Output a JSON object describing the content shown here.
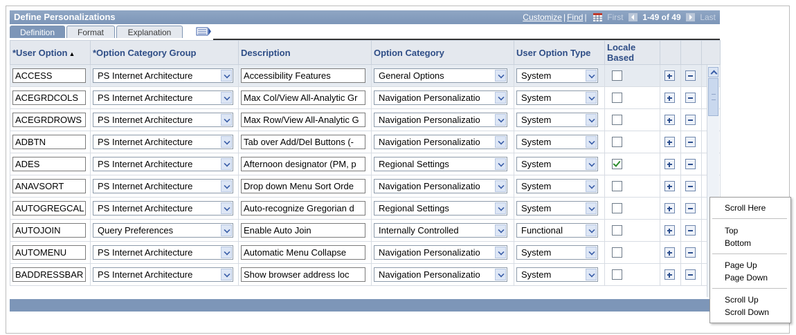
{
  "header": {
    "title": "Define Personalizations",
    "customize": "Customize",
    "find": "Find",
    "first": "First",
    "range": "1-49 of 49",
    "last": "Last"
  },
  "tabs": [
    "Definition",
    "Format",
    "Explanation"
  ],
  "columns": [
    "*User Option",
    "*Option Category Group",
    "Description",
    "Option Category",
    "User Option Type",
    "Locale Based"
  ],
  "rows": [
    {
      "user_option": "ACCESS",
      "group": "PS Internet Architecture",
      "description": "Accessibility Features",
      "category": "General Options",
      "type": "System",
      "locale": false
    },
    {
      "user_option": "ACEGRDCOLS",
      "group": "PS Internet Architecture",
      "description": "Max Col/View All-Analytic Gr",
      "category": "Navigation Personalizatio",
      "type": "System",
      "locale": false
    },
    {
      "user_option": "ACEGRDROWS",
      "group": "PS Internet Architecture",
      "description": "Max Row/View All-Analytic G",
      "category": "Navigation Personalizatio",
      "type": "System",
      "locale": false
    },
    {
      "user_option": "ADBTN",
      "group": "PS Internet Architecture",
      "description": "Tab over Add/Del Buttons (-",
      "category": "Navigation Personalizatio",
      "type": "System",
      "locale": false
    },
    {
      "user_option": "ADES",
      "group": "PS Internet Architecture",
      "description": "Afternoon designator (PM, p",
      "category": "Regional Settings",
      "type": "System",
      "locale": true
    },
    {
      "user_option": "ANAVSORT",
      "group": "PS Internet Architecture",
      "description": "Drop down Menu Sort Orde",
      "category": "Navigation Personalizatio",
      "type": "System",
      "locale": false
    },
    {
      "user_option": "AUTOGREGCAL",
      "group": "PS Internet Architecture",
      "description": "Auto-recognize Gregorian d",
      "category": "Regional Settings",
      "type": "System",
      "locale": false
    },
    {
      "user_option": "AUTOJOIN",
      "group": "Query Preferences",
      "description": "Enable Auto Join",
      "category": "Internally Controlled",
      "type": "Functional",
      "locale": false
    },
    {
      "user_option": "AUTOMENU",
      "group": "PS Internet Architecture",
      "description": "Automatic Menu Collapse",
      "category": "Navigation Personalizatio",
      "type": "System",
      "locale": false
    },
    {
      "user_option": "BADDRESSBAR",
      "group": "PS Internet Architecture",
      "description": "Show browser address loc",
      "category": "Navigation Personalizatio",
      "type": "System",
      "locale": false
    }
  ],
  "context_menu": [
    "Scroll Here",
    "Top",
    "Bottom",
    "Page Up",
    "Page Down",
    "Scroll Up",
    "Scroll Down"
  ],
  "colors": {
    "header_bar": "#7d96b8",
    "column_header_text": "#2e4d86",
    "grid_header_bg": "#e4e8ee"
  }
}
